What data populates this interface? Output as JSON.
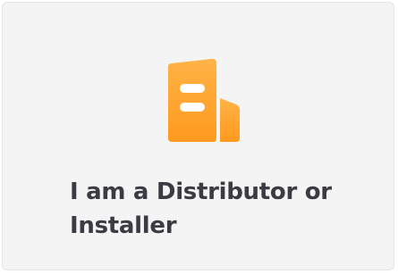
{
  "card": {
    "icon": "building-icon",
    "title": "I am a Distributor or Installer",
    "colors": {
      "accent_light": "#ffb347",
      "accent_dark": "#ff9a1f",
      "background": "#f4f4f5",
      "title": "#3b3b43"
    }
  }
}
